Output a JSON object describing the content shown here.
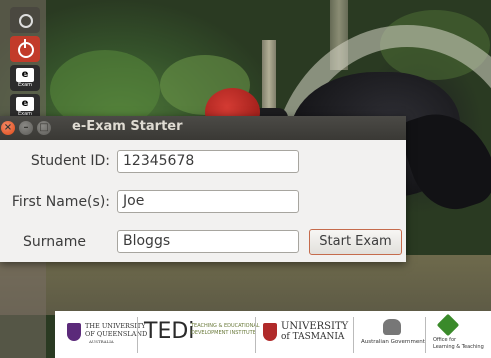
{
  "window": {
    "title": "e-Exam Starter"
  },
  "form": {
    "student_id": {
      "label": "Student ID:",
      "value": "12345678"
    },
    "first_name": {
      "label": "First Name(s):",
      "value": "Joe"
    },
    "surname": {
      "label": "Surname",
      "value": "Bloggs"
    },
    "start_button_label": "Start Exam"
  },
  "launcher": {
    "items": [
      {
        "name": "dash",
        "icon": "ubuntu-dash-icon"
      },
      {
        "name": "power",
        "icon": "power-icon"
      },
      {
        "name": "eexam",
        "icon": "eexam-icon",
        "label": "e",
        "sub": "Exam"
      },
      {
        "name": "eexam-2",
        "icon": "eexam-icon",
        "label": "e",
        "sub": "Exam"
      }
    ]
  },
  "logos": {
    "uq_line1": "THE UNIVERSITY",
    "uq_line2": "OF QUEENSLAND",
    "uq_line3": "AUSTRALIA",
    "tedi": "TEDi",
    "tedi_sub1": "TEACHING & EDUCATIONAL",
    "tedi_sub2": "DEVELOPMENT INSTITUTE",
    "utas_line1": "UNIVERSITY",
    "utas_line2": "of TASMANIA",
    "gov": "Australian Government",
    "olt1": "Office for",
    "olt2": "Learning & Teaching"
  },
  "colors": {
    "close": "#df4a16",
    "titlebar": "#3c3b37",
    "accent_border": "#c56b4c"
  }
}
